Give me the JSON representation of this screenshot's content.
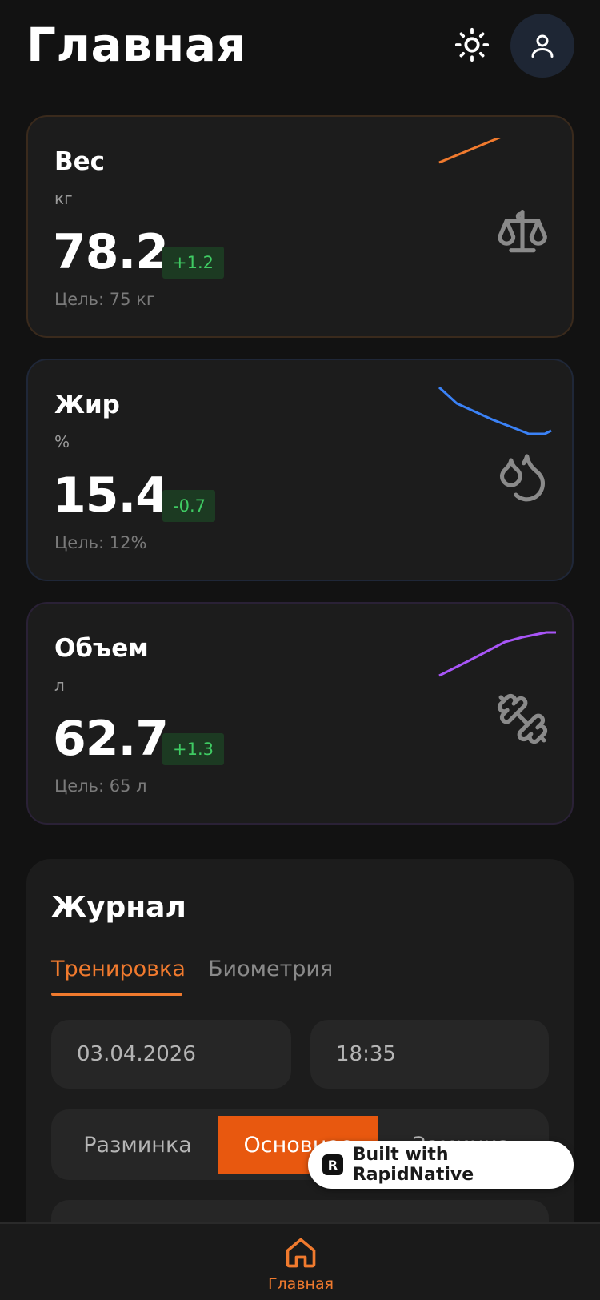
{
  "header": {
    "title": "Главная"
  },
  "cards": [
    {
      "title": "Вес",
      "unit": "кг",
      "value": "78.2",
      "delta": "+1.2",
      "goal": "Цель: 75 кг",
      "color": "#f07a2e",
      "icon": "scale-icon"
    },
    {
      "title": "Жир",
      "unit": "%",
      "value": "15.4",
      "delta": "-0.7",
      "goal": "Цель: 12%",
      "color": "#3b82f6",
      "icon": "droplets-icon"
    },
    {
      "title": "Объем",
      "unit": "л",
      "value": "62.7",
      "delta": "+1.3",
      "goal": "Цель: 65 л",
      "color": "#a855f7",
      "icon": "dumbbell-icon"
    }
  ],
  "journal": {
    "title": "Журнал",
    "tabs": [
      "Тренировка",
      "Биометрия"
    ],
    "date": "03.04.2026",
    "time": "18:35",
    "segments": [
      "Разминка",
      "Основное",
      "Заминка"
    ]
  },
  "badge": {
    "text": "Built with RapidNative"
  },
  "nav": {
    "home_label": "Главная"
  },
  "colors": {
    "accent": "#f07a2e",
    "positive": "#3fcb63",
    "background": "#121212"
  }
}
